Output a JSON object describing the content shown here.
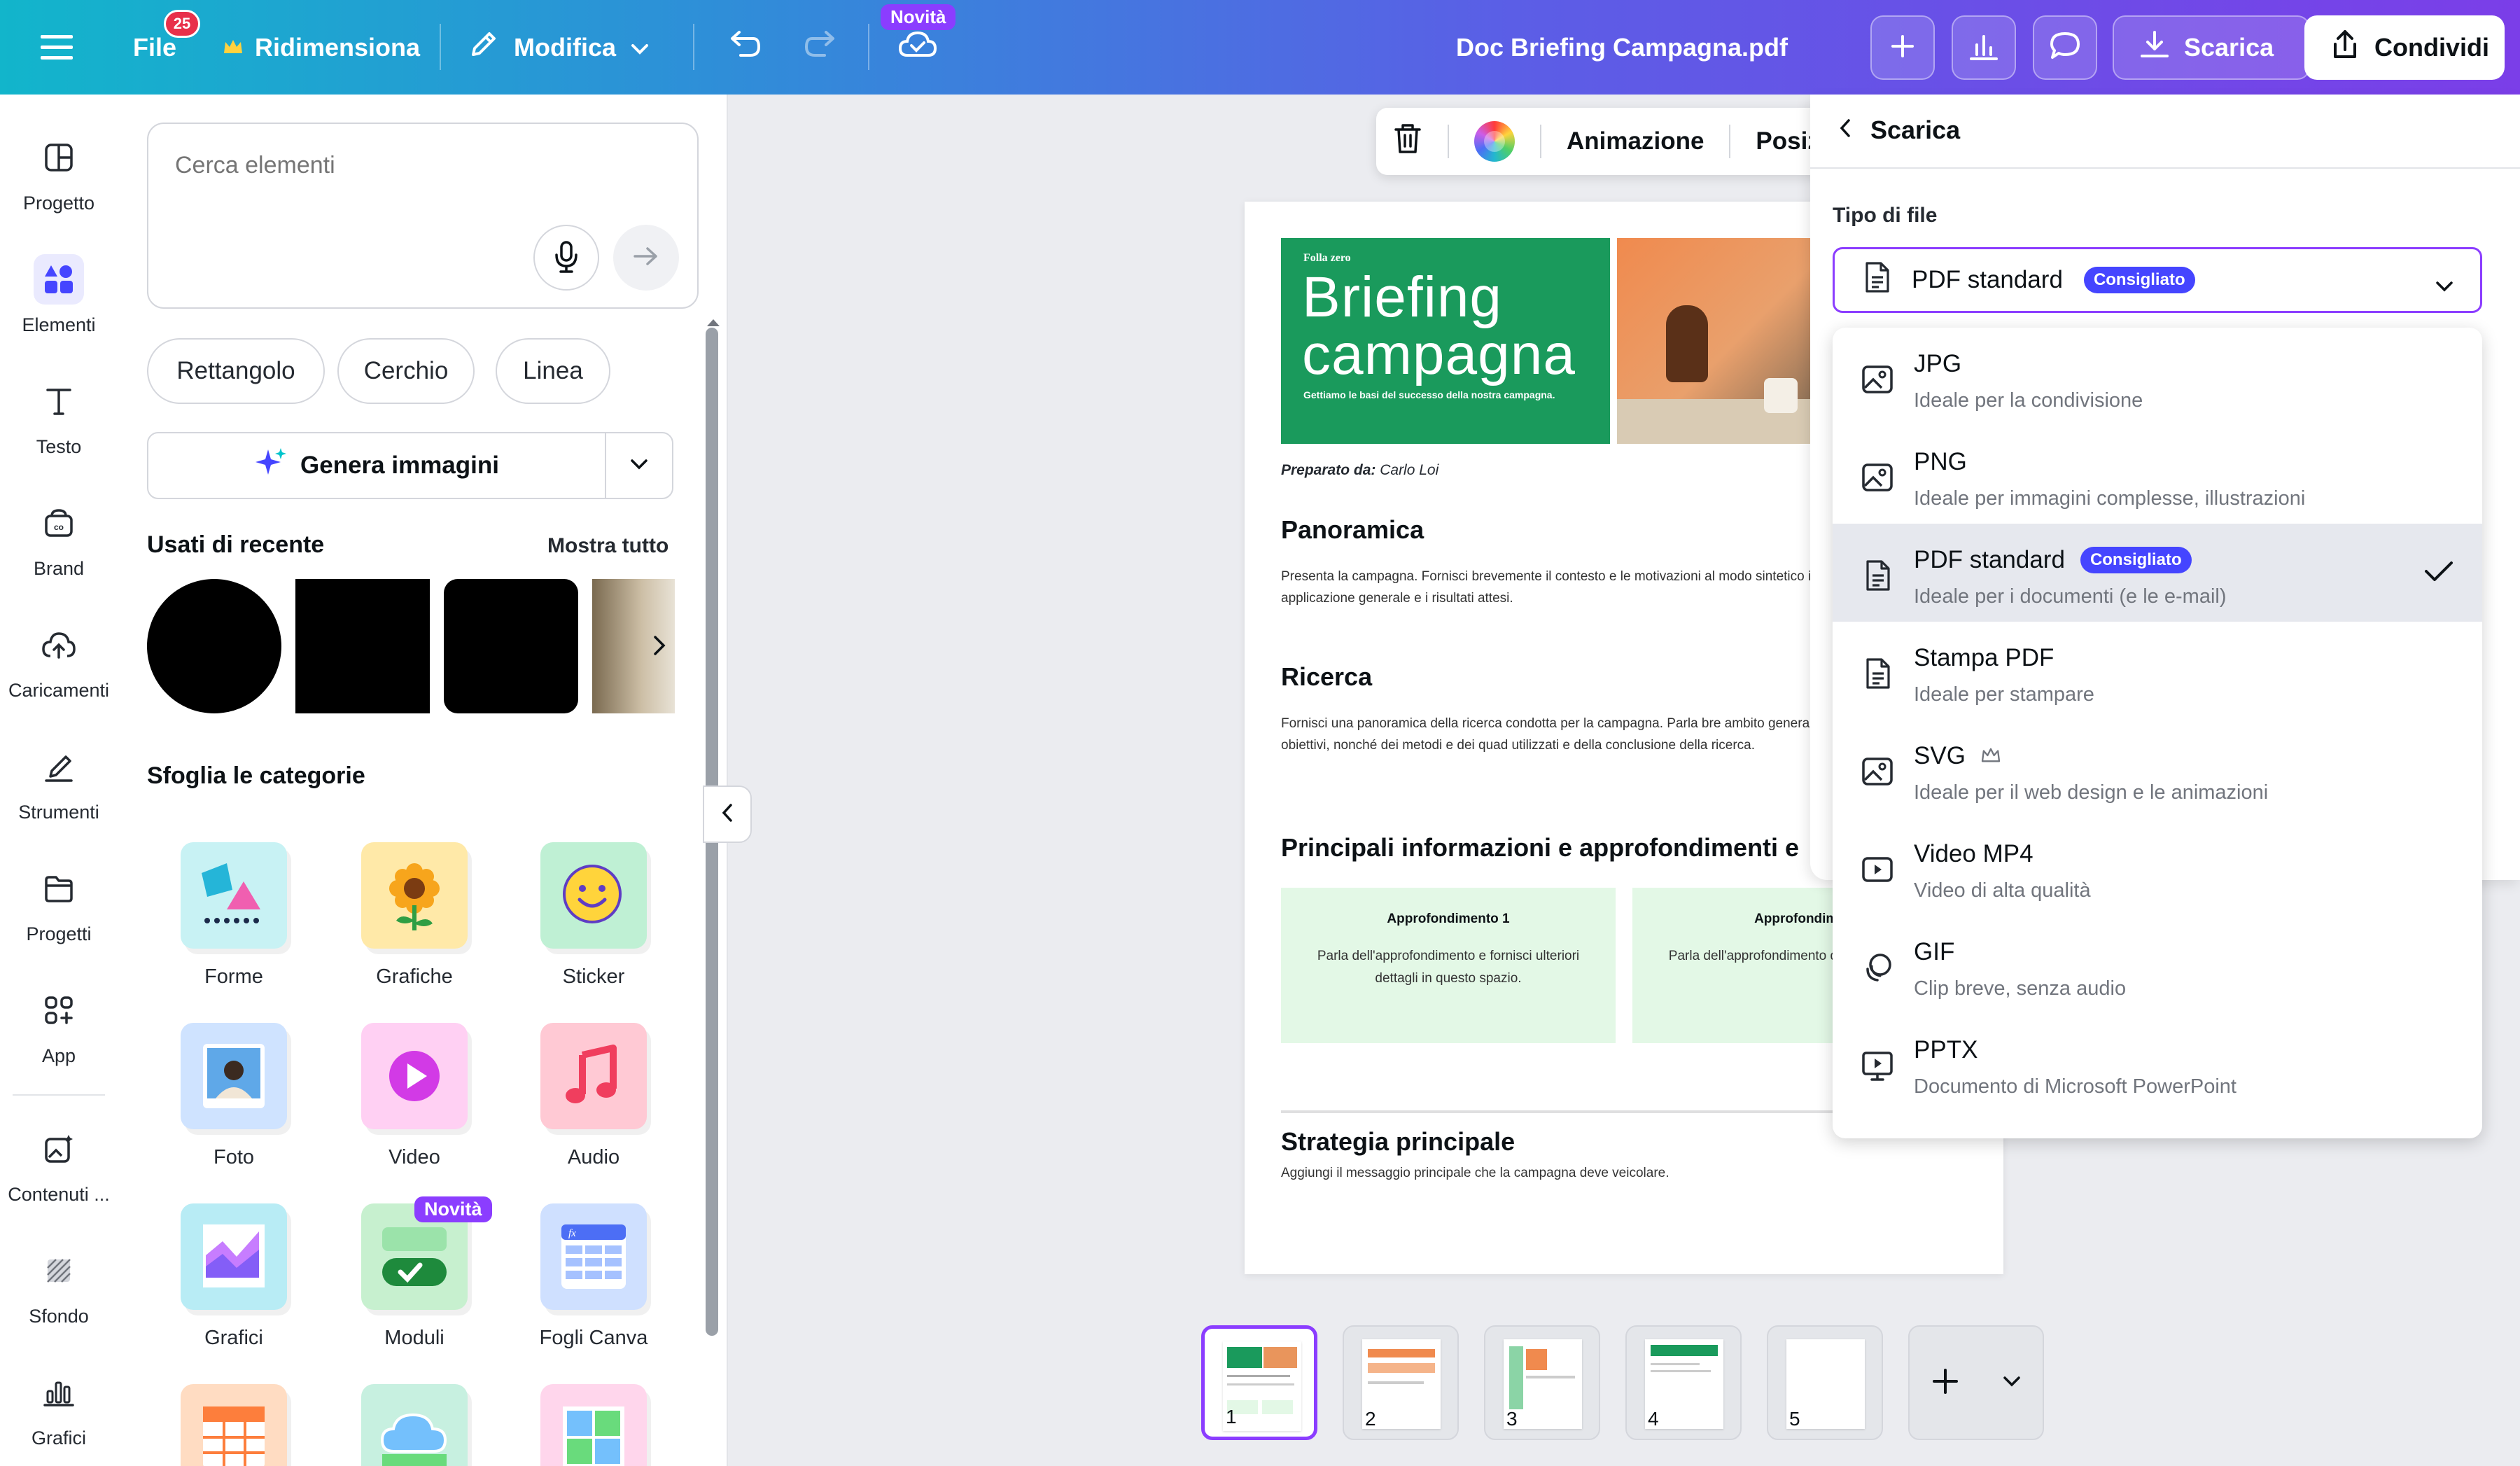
{
  "topbar": {
    "file_label": "File",
    "file_badge": "25",
    "resize_label": "Ridimensiona",
    "edit_label": "Modifica",
    "new_badge": "Novità",
    "doc_title": "Doc Briefing Campagna.pdf",
    "download_label": "Scarica",
    "share_label": "Condividi"
  },
  "rail": {
    "items": [
      {
        "label": "Progetto",
        "icon": "layout-icon"
      },
      {
        "label": "Elementi",
        "icon": "elements-icon"
      },
      {
        "label": "Testo",
        "icon": "text-icon"
      },
      {
        "label": "Brand",
        "icon": "brand-icon"
      },
      {
        "label": "Caricamenti",
        "icon": "upload-icon"
      },
      {
        "label": "Strumenti",
        "icon": "draw-icon"
      },
      {
        "label": "Progetti",
        "icon": "folder-icon"
      },
      {
        "label": "App",
        "icon": "apps-icon"
      },
      {
        "label": "Contenuti ...",
        "icon": "magic-media-icon"
      },
      {
        "label": "Sfondo",
        "icon": "background-icon"
      },
      {
        "label": "Grafici",
        "icon": "charts-icon"
      }
    ]
  },
  "panel": {
    "search_placeholder": "Cerca elementi",
    "chips": [
      "Rettangolo",
      "Cerchio",
      "Linea"
    ],
    "generate_label": "Genera immagini",
    "recent_title": "Usati di recente",
    "show_all": "Mostra tutto",
    "categories_title": "Sfoglia le categorie",
    "categories": [
      {
        "label": "Forme"
      },
      {
        "label": "Grafiche"
      },
      {
        "label": "Sticker"
      },
      {
        "label": "Foto"
      },
      {
        "label": "Video"
      },
      {
        "label": "Audio"
      },
      {
        "label": "Grafici"
      },
      {
        "label": "Moduli",
        "badge": "Novità"
      },
      {
        "label": "Fogli Canva"
      }
    ]
  },
  "context_toolbar": {
    "animation_label": "Animazione",
    "position_label": "Posiz"
  },
  "document": {
    "hero_kicker": "Folla zero",
    "hero_title_1": "Briefing",
    "hero_title_2": "campagna",
    "hero_sub": "Gettiamo le basi del successo della nostra campagna.",
    "prepared_by_label": "Preparato da:",
    "prepared_by_name": "Carlo Loi",
    "h_overview": "Panoramica",
    "p_overview": "Presenta la campagna. Fornisci brevemente il contesto e le motivazioni al modo sintetico il suo ambito di applicazione generale e i risultati attesi.",
    "h_research": "Ricerca",
    "p_research": "Fornisci una panoramica della ricerca condotta per la campagna. Parla bre ambito generale, degli scopi e degli obiettivi, nonché dei metodi e dei quad utilizzati e della conclusione della ricerca.",
    "h_insights": "Principali informazioni e approfondimenti e",
    "insights": [
      {
        "title": "Approfondimento 1",
        "body": "Parla dell'approfondimento e fornisci ulteriori dettagli in questo spazio."
      },
      {
        "title": "Approfondime",
        "body": "Parla dell'approfondimento dettagli in questo"
      }
    ],
    "h_strategy": "Strategia principale",
    "p_strategy": "Aggiungi il messaggio principale che la campagna deve veicolare."
  },
  "pages": [
    "1",
    "2",
    "3",
    "4",
    "5"
  ],
  "download": {
    "back_title": "Scarica",
    "file_type_label": "Tipo di file",
    "selected_value": "PDF standard",
    "recommended": "Consigliato",
    "options": [
      {
        "title": "JPG",
        "sub": "Ideale per la condivisione",
        "icon": "image-icon"
      },
      {
        "title": "PNG",
        "sub": "Ideale per immagini complesse, illustrazioni",
        "icon": "image-icon"
      },
      {
        "title": "PDF standard",
        "sub": "Ideale per i documenti (e le e-mail)",
        "icon": "document-icon",
        "badge": "Consigliato",
        "selected": true
      },
      {
        "title": "Stampa PDF",
        "sub": "Ideale per stampare",
        "icon": "document-icon"
      },
      {
        "title": "SVG",
        "sub": "Ideale per il web design e le animazioni",
        "icon": "image-icon",
        "premium": true
      },
      {
        "title": "Video MP4",
        "sub": "Video di alta qualità",
        "icon": "video-icon"
      },
      {
        "title": "GIF",
        "sub": "Clip breve, senza audio",
        "icon": "gif-icon"
      },
      {
        "title": "PPTX",
        "sub": "Documento di Microsoft PowerPoint",
        "icon": "presentation-icon"
      }
    ]
  },
  "colors": {
    "accent": "#8b3dff",
    "badge_blue": "#4545ff",
    "doc_green": "#1a9a5c"
  }
}
